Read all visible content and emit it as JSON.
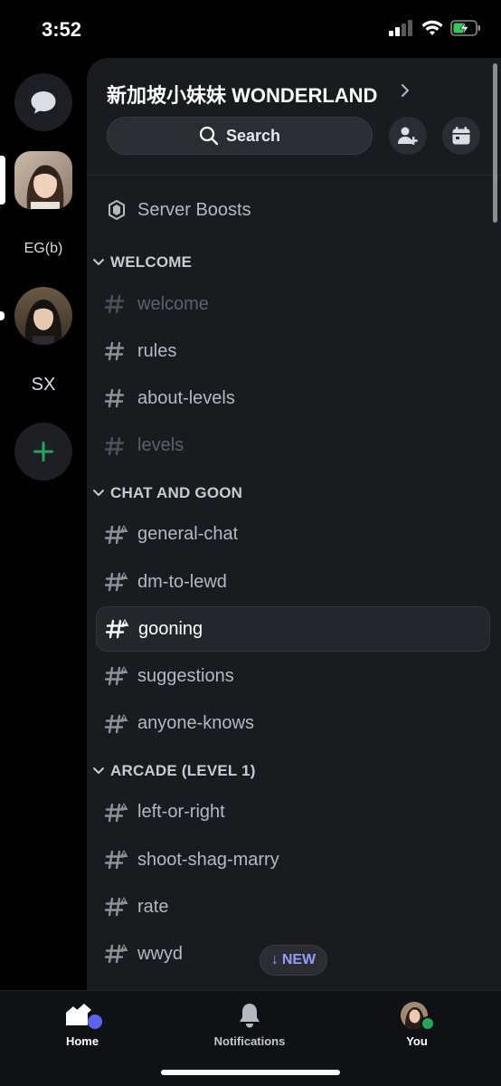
{
  "status_bar": {
    "time": "3:52"
  },
  "rail": {
    "dm_icon": "chat-bubble-icon",
    "servers": [
      {
        "type": "avatar",
        "name": "server-avatar-1",
        "selected": true
      },
      {
        "type": "text",
        "label": "EG(b)"
      },
      {
        "type": "avatar",
        "name": "server-avatar-2",
        "unread": true
      },
      {
        "type": "text",
        "label": "SX"
      }
    ],
    "add_icon": "plus-icon"
  },
  "server": {
    "name": "新加坡小妹妹 WONDERLAND",
    "search_label": "Search",
    "boosts_label": "Server Boosts"
  },
  "categories": [
    {
      "label": "WELCOME",
      "channels": [
        {
          "name": "welcome",
          "muted": true,
          "locked": false
        },
        {
          "name": "rules",
          "muted": false,
          "locked": false
        },
        {
          "name": "about-levels",
          "muted": false,
          "locked": false
        },
        {
          "name": "levels",
          "muted": true,
          "locked": false
        }
      ]
    },
    {
      "label": "CHAT AND GOON",
      "channels": [
        {
          "name": "general-chat",
          "locked": true
        },
        {
          "name": "dm-to-lewd",
          "locked": true
        },
        {
          "name": "gooning",
          "locked": true,
          "active": true
        },
        {
          "name": "suggestions",
          "locked": true
        },
        {
          "name": "anyone-knows",
          "locked": true
        }
      ]
    },
    {
      "label": "ARCADE (LEVEL 1)",
      "channels": [
        {
          "name": "left-or-right",
          "locked": true
        },
        {
          "name": "shoot-shag-marry",
          "locked": true
        },
        {
          "name": "rate",
          "locked": true
        },
        {
          "name": "wwyd",
          "locked": true
        }
      ]
    }
  ],
  "new_pill": {
    "label": "NEW"
  },
  "bottom_nav": {
    "home": "Home",
    "notifications": "Notifications",
    "you": "You"
  },
  "colors": {
    "accent": "#5865f2",
    "online": "#23a55a",
    "new_text": "#949cf7",
    "add_green": "#23a55a"
  }
}
